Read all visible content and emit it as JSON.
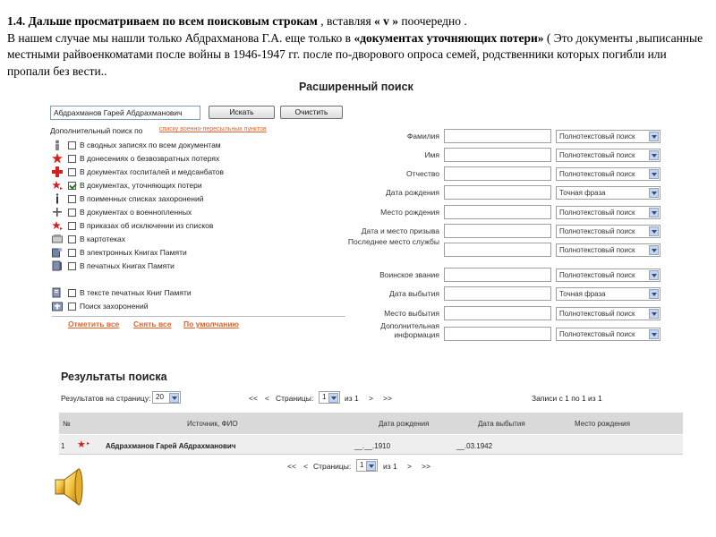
{
  "intro": {
    "line1_bold": "1.4. Дальше просматриваем по всем поисковым строкам",
    "line1_rest": " , вставляя ",
    "line1_v": "« v »",
    "line1_end": " поочередно .",
    "line2_a": " В нашем случае мы нашли только Абдрахманова Г.А. еще только в ",
    "line2_bold": "«документах уточняющих потери»",
    "line2_b": " ( Это документы ,выписанные местными  райвоенкоматами после войны в 1946-1947 гг.  после по-дворового опроса семей, родственники которых погибли или пропали без вести.."
  },
  "search": {
    "heading": "Расширенный поиск",
    "query_value": "Абдрахманов Гарей Абдрахманович",
    "search_button": "Искать",
    "clear_button": "Очистить",
    "additional_label": "Дополнительный поиск по",
    "additional_link": "спискy военно-пересыльных пунктов"
  },
  "sources": [
    {
      "label": "В сводных записях по всем документам",
      "checked": false,
      "icon": "soldier-icon"
    },
    {
      "label": "В донесениях о безвозвратных потерях",
      "checked": false,
      "icon": "red-star-icon"
    },
    {
      "label": "В документах госпиталей и медсанбатов",
      "checked": false,
      "icon": "red-cross-icon"
    },
    {
      "label": "В документах, уточняющих потери",
      "checked": true,
      "icon": "star-arrow-icon"
    },
    {
      "label": "В поименных списках захоронений",
      "checked": false,
      "icon": "monument-icon"
    },
    {
      "label": "В документах о военнопленных",
      "checked": false,
      "icon": "plane-icon"
    },
    {
      "label": "В приказах об исключении из списков",
      "checked": false,
      "icon": "star-arrow-icon"
    },
    {
      "label": "В картотеках",
      "checked": false,
      "icon": "card-file-icon"
    },
    {
      "label": "В электронных Книгах Памяти",
      "checked": false,
      "icon": "ebook-icon"
    },
    {
      "label": "В печатных Книгах Памяти",
      "checked": false,
      "icon": "book-icon"
    },
    {
      "label": "В тексте печатных Книг Памяти",
      "checked": false,
      "icon": "book-text-icon"
    },
    {
      "label": "Поиск захоронений",
      "checked": false,
      "icon": "grave-icon"
    }
  ],
  "bulk_links": {
    "mark_all": "Отметить все",
    "unmark_all": "Снять все",
    "default": "По умолчанию"
  },
  "fields": [
    {
      "label": "Фамилия",
      "mode": "Полнотекстовый поиск"
    },
    {
      "label": "Имя",
      "mode": "Полнотекстовый поиск"
    },
    {
      "label": "Отчество",
      "mode": "Полнотекстовый поиск"
    },
    {
      "label": "Дата рождения",
      "mode": "Точная фраза"
    },
    {
      "label": "Место рождения",
      "mode": "Полнотекстовый поиск"
    },
    {
      "label": "Дата и место призыва",
      "mode": "Полнотекстовый поиск"
    },
    {
      "label": "Последнее место службы",
      "mode": "Полнотекстовый поиск"
    },
    {
      "label": "Воинское звание",
      "mode": "Полнотекстовый поиск"
    },
    {
      "label": "Дата выбытия",
      "mode": "Точная фраза"
    },
    {
      "label": "Место выбытия",
      "mode": "Полнотекстовый поиск"
    },
    {
      "label": "Дополнительная информация",
      "mode": "Полнотекстовый поиск"
    }
  ],
  "results": {
    "title": "Результаты поиска",
    "per_page_label": "Результатов на страницу:",
    "per_page_value": "20",
    "first": "<<",
    "prev": "<",
    "pages_label": "Страницы:",
    "page_value": "1",
    "of_label": "из 1",
    "next": ">",
    "last": ">>",
    "records_info": "Записи с 1 по 1 из 1",
    "columns": {
      "num": "№",
      "source": "Источник, ФИО",
      "birth_date": "Дата рождения",
      "leave_date": "Дата выбытия",
      "birth_place": "Место рождения"
    },
    "rows": [
      {
        "num": "1",
        "name": "Абдрахманов Гарей Абдрахманович",
        "birth_date": "__.__.1910",
        "leave_date": "__.03.1942",
        "birth_place": ""
      }
    ]
  },
  "colors": {
    "link": "#e4632a",
    "star": "#d42020",
    "header_bg": "#d9d9d9"
  }
}
